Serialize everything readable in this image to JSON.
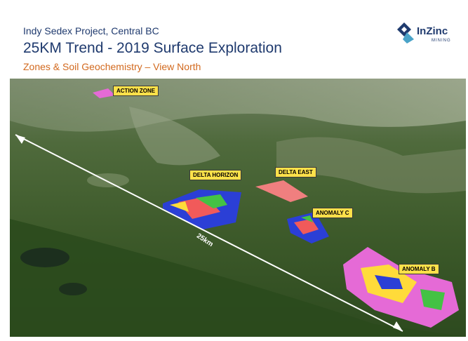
{
  "header": {
    "subtitle": "Indy Sedex Project, Central BC",
    "title": "25KM Trend - 2019 Surface Exploration",
    "caption": "Zones & Soil Geochemistry – View North"
  },
  "logo": {
    "name": "InZinc",
    "tagline": "MINING",
    "icon": "inzinc-logo-icon",
    "color": "#1f3a6e"
  },
  "map": {
    "zones": [
      {
        "label": "ACTION ZONE"
      },
      {
        "label": "DELTA HORIZON"
      },
      {
        "label": "DELTA EAST"
      },
      {
        "label": "ANOMALY C"
      },
      {
        "label": "ANOMALY B"
      }
    ],
    "distance_label": "25km",
    "label_color": "#ffe14a"
  }
}
